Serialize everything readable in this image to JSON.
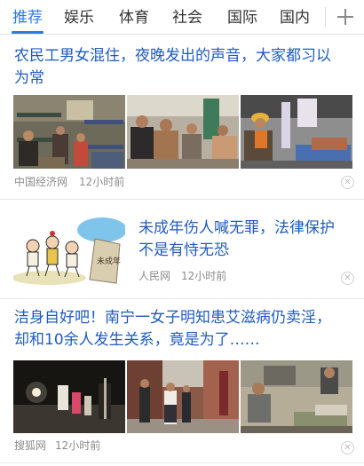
{
  "tabs": [
    {
      "label": "推荐",
      "active": true
    },
    {
      "label": "娱乐",
      "active": false
    },
    {
      "label": "体育",
      "active": false
    },
    {
      "label": "社会",
      "active": false
    },
    {
      "label": "国际",
      "active": false
    },
    {
      "label": "国内",
      "active": false
    }
  ],
  "add_channel_icon": "plus-icon",
  "accent_color": "#2d7be5",
  "headline_color": "#1f5bc0",
  "news": [
    {
      "headline_line1": "农民工男女混住，夜晚发出的声音，大家都习以",
      "headline_line2": "为常",
      "source": "中国经济网",
      "time": "12小时前",
      "images": [
        "dormitory-bunk-beds-photo",
        "workers-sitting-in-room-photo",
        "worker-in-hardhat-photo"
      ]
    },
    {
      "headline_line1": "未成年伤人喊无罪，法律保护",
      "headline_line2": "不是有恃无恐",
      "source": "人民网",
      "time": "12小时前",
      "images": [
        "cartoon-minors-illustration"
      ],
      "cartoon_sign": "未成年"
    },
    {
      "headline_line1": "洁身自好吧！南宁一女子明知患艾滋病仍卖淫，",
      "headline_line2": "却和10余人发生关系，竟是为了……",
      "source": "搜狐网",
      "time": "12小时前",
      "images": [
        "night-street-photo",
        "alley-people-walking-photo",
        "person-in-rundown-room-photo"
      ]
    }
  ],
  "dismiss_icon": "close-icon"
}
